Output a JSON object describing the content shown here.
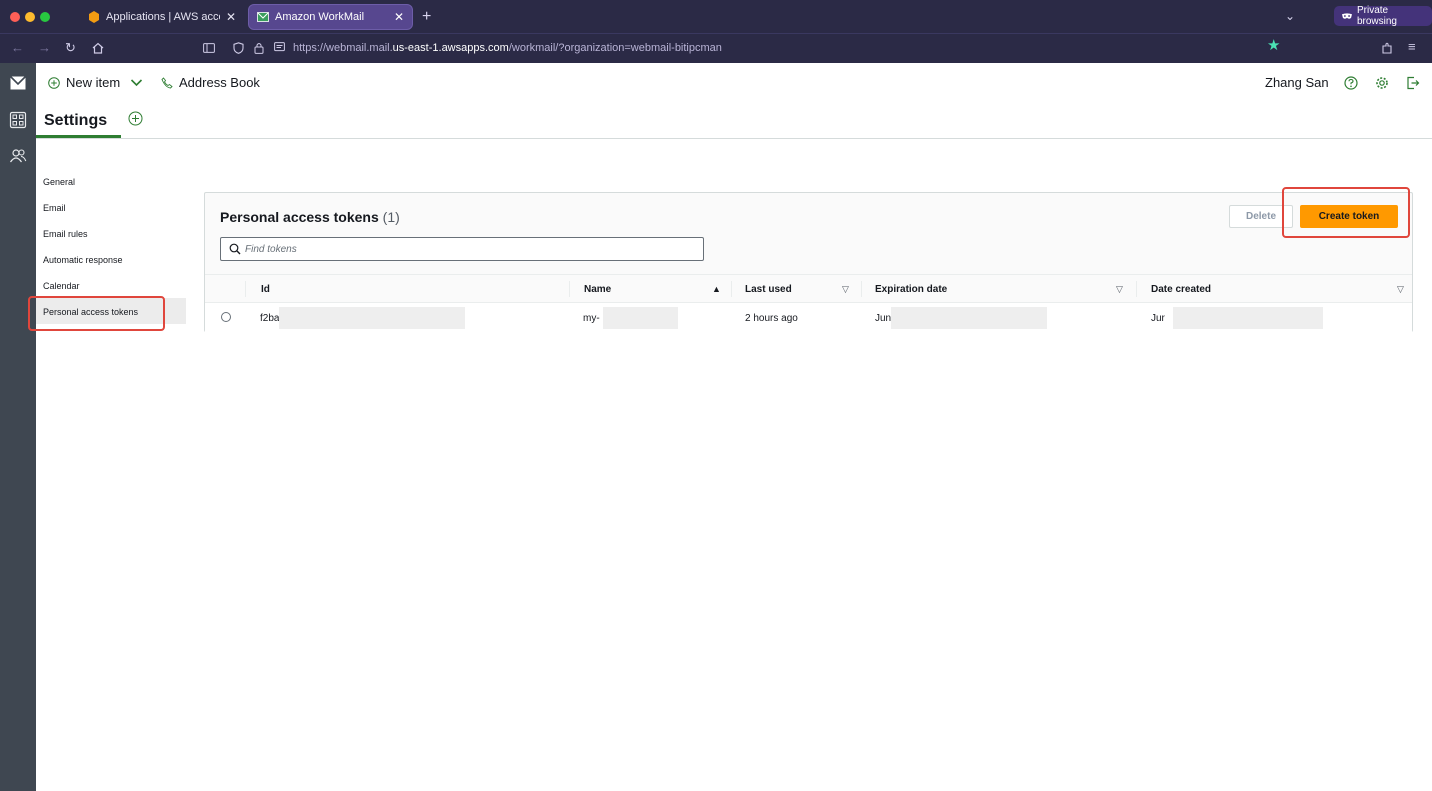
{
  "browser": {
    "tabs": [
      {
        "title": "Applications | AWS access porta",
        "active": false
      },
      {
        "title": "Amazon WorkMail",
        "active": true
      }
    ],
    "private_label": "Private browsing",
    "url_prefix": "https://webmail.mail.",
    "url_host": "us-east-1.awsapps.com",
    "url_suffix": "/workmail/?organization=webmail-bitipcman"
  },
  "toolbar": {
    "new_item": "New item",
    "address_book": "Address Book",
    "user_name": "Zhang San"
  },
  "tabs": {
    "settings": "Settings"
  },
  "sidebar": {
    "items": [
      {
        "label": "General"
      },
      {
        "label": "Email"
      },
      {
        "label": "Email rules"
      },
      {
        "label": "Automatic response"
      },
      {
        "label": "Calendar"
      },
      {
        "label": "Personal access tokens"
      }
    ],
    "active_index": 5
  },
  "panel": {
    "title": "Personal access tokens",
    "count": "(1)",
    "delete_label": "Delete",
    "create_label": "Create token",
    "search_placeholder": "Find tokens",
    "columns": [
      "Id",
      "Name",
      "Last used",
      "Expiration date",
      "Date created"
    ],
    "rows": [
      {
        "id": "f2ba",
        "name": "my-",
        "last_used": "2 hours ago",
        "expiration": "Jun",
        "created": "Jur"
      }
    ]
  },
  "colors": {
    "accent_orange": "#ff9900",
    "tab_underline": "#2e7d32",
    "highlight": "#e0463c"
  },
  "icons": [
    "mail-icon",
    "apps-icon",
    "contacts-icon",
    "plus-circle-icon",
    "chevron-down-icon",
    "phone-icon",
    "help-icon",
    "gear-icon",
    "logout-icon",
    "search-icon"
  ]
}
